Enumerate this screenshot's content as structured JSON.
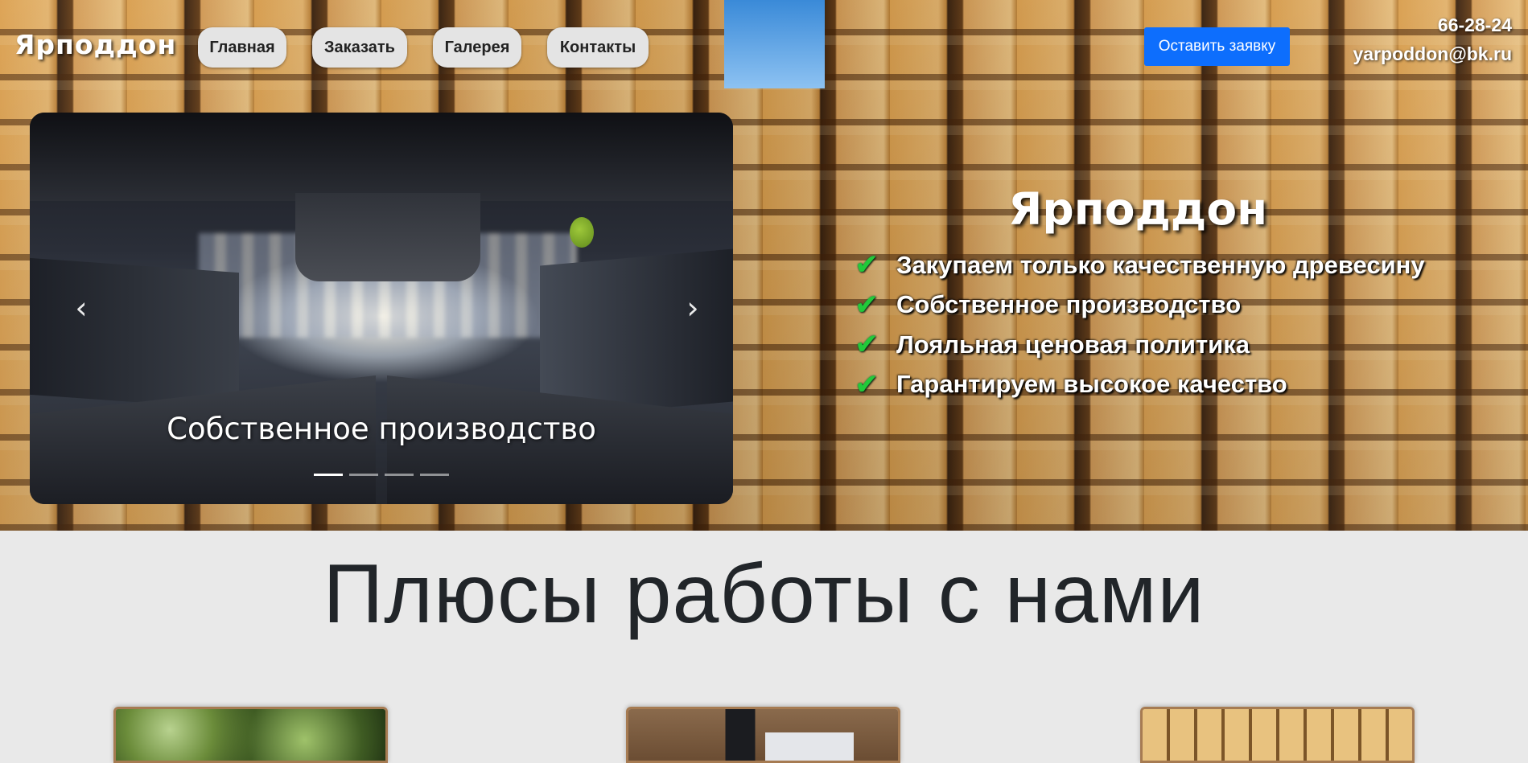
{
  "header": {
    "logo": "Ярподдон",
    "nav": [
      {
        "label": "Главная"
      },
      {
        "label": "Заказать"
      },
      {
        "label": "Галерея"
      },
      {
        "label": "Контакты"
      }
    ],
    "cta_label": "Оставить заявку",
    "phone": "66-28-24",
    "email": "yarpoddon@bk.ru"
  },
  "carousel": {
    "caption": "Собственное производство",
    "prev_icon": "chevron-left-icon",
    "next_icon": "chevron-right-icon",
    "indicator_count": 4,
    "active_index": 0
  },
  "hero": {
    "title": "Ярподдон",
    "features": [
      "Закупаем только качественную древесину",
      "Собственное производство",
      "Лояльная ценовая политика",
      "Гарантируем высокое качество"
    ],
    "check_icon": "checkmark-icon",
    "check_color": "#22c93a"
  },
  "benefits": {
    "title": "Плюсы работы с нами"
  },
  "colors": {
    "accent": "#0d6efd",
    "nav_pill": "#e4e4e4",
    "section_bg": "#e9e9e9",
    "card_border": "#a67b52"
  }
}
